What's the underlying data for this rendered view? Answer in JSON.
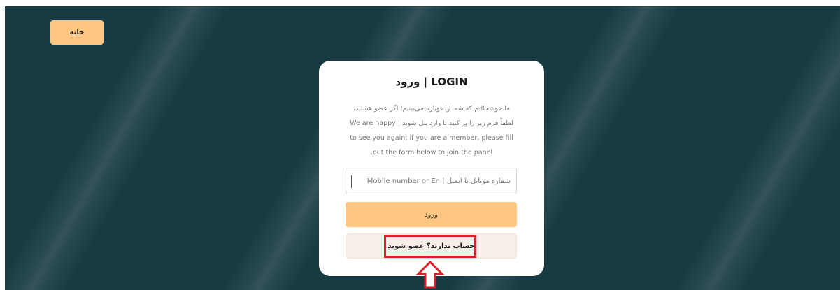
{
  "nav": {
    "home_label": "خانه"
  },
  "login": {
    "title": "ورود | LOGIN",
    "description_lines": [
      "ما خوشحالیم که شما را دوباره می‌بینیم؛ اگر عضو هستید،",
      "لطفاً فرم زیر را پر کنید تا وارد پنل شوید | We are happy",
      "to see you again; if you are a member, please fill",
      "out the form below to join the panel."
    ],
    "input_placeholder": "شماره موبایل یا ایمیل | Mobile number or En",
    "submit_label": "ورود",
    "signup_label": "حساب ندارید؟ عضو شوید"
  },
  "colors": {
    "background": "#173a43",
    "accent": "#fdc683",
    "highlight": "#d8202a"
  }
}
